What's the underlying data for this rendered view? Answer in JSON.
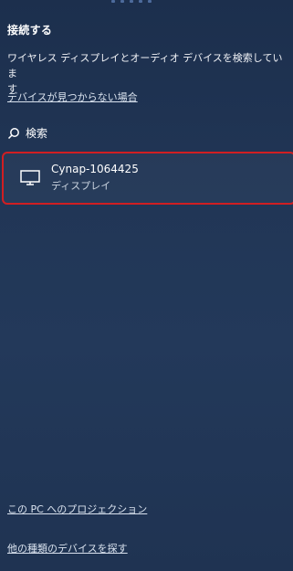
{
  "panel": {
    "title": "接続する",
    "description": "ワイヤレス ディスプレイとオーディオ デバイスを検索していま\nす",
    "missing_link": "デバイスが見つからない場合",
    "search_label": "検索"
  },
  "device": {
    "name": "Cynap-1064425",
    "type": "ディスプレイ",
    "icon": "monitor-icon"
  },
  "footer": {
    "project_link": "この PC へのプロジェクション",
    "other_devices_link": "他の種類のデバイスを探す"
  },
  "colors": {
    "background": "#1f3250",
    "highlight": "#d11e22",
    "text": "#ffffff"
  }
}
